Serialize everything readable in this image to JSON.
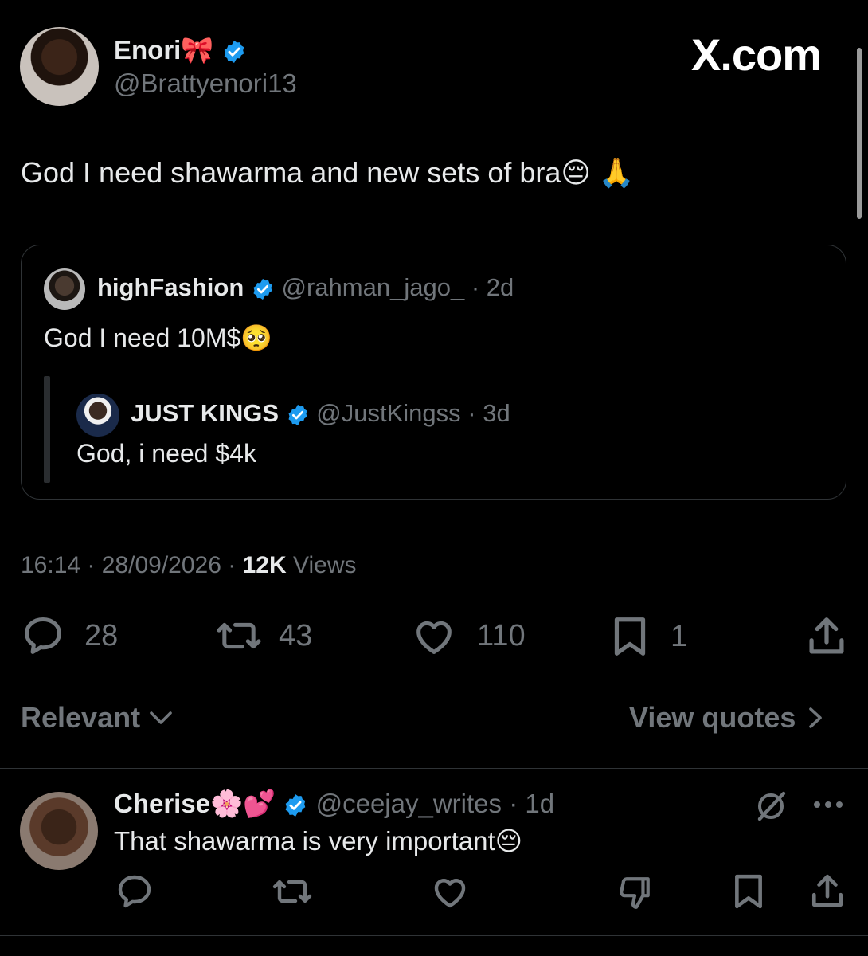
{
  "watermark": "X.com",
  "tweet": {
    "author_name": "Enori🎀",
    "author_handle": "@Brattyenori13",
    "text": "God I need shawarma and new sets of bra😔 🙏",
    "time": "16:14",
    "date": "28/09/2026",
    "views_count": "12K",
    "views_label": "Views",
    "replies": "28",
    "reposts": "43",
    "likes": "110",
    "bookmarks": "1"
  },
  "quote": {
    "author_name": "highFashion",
    "author_handle": "@rahman_jago_",
    "age": "2d",
    "text": "God I need 10M$🥺",
    "nested": {
      "author_name": "JUST KINGS",
      "author_handle": "@JustKingss",
      "age": "3d",
      "text": "God, i need $4k"
    }
  },
  "sort": {
    "label": "Relevant",
    "view_quotes": "View quotes"
  },
  "reply": {
    "author_name": "Cherise🌸💕",
    "author_handle": "@ceejay_writes",
    "age": "1d",
    "text": "That shawarma is very important😔"
  },
  "colors": {
    "background": "#000000",
    "text": "#e7e9ea",
    "secondary": "#71767b",
    "verified": "#1d9bf0",
    "border": "#2f3336"
  }
}
